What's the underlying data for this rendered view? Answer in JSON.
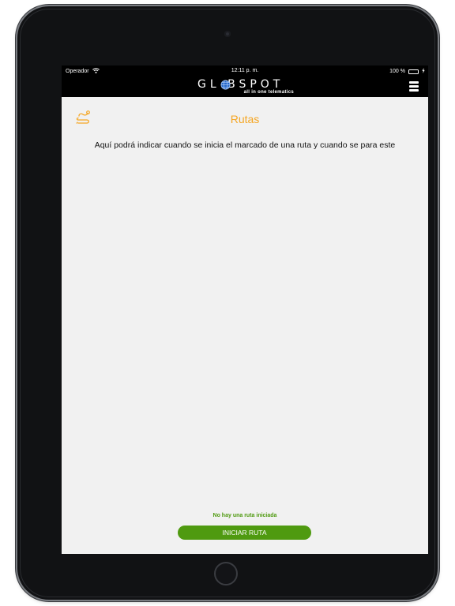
{
  "status_bar": {
    "carrier": "Operador",
    "time": "12:11 p. m.",
    "battery_percent": "100 %"
  },
  "nav": {
    "logo_text": "GL BSPOT",
    "logo_tagline": "all in one telematics",
    "menu_icon": "hamburger-icon"
  },
  "page": {
    "title": "Rutas",
    "description": "Aquí podrá indicar cuando se inicia el marcado de una ruta y cuando se para este",
    "route_status": "No hay una ruta iniciada",
    "start_button_label": "INICIAR RUTA"
  },
  "colors": {
    "accent_orange": "#f5a623",
    "action_green": "#4f9a10",
    "screen_background": "#f1f1f1",
    "bar_background": "#000000"
  }
}
